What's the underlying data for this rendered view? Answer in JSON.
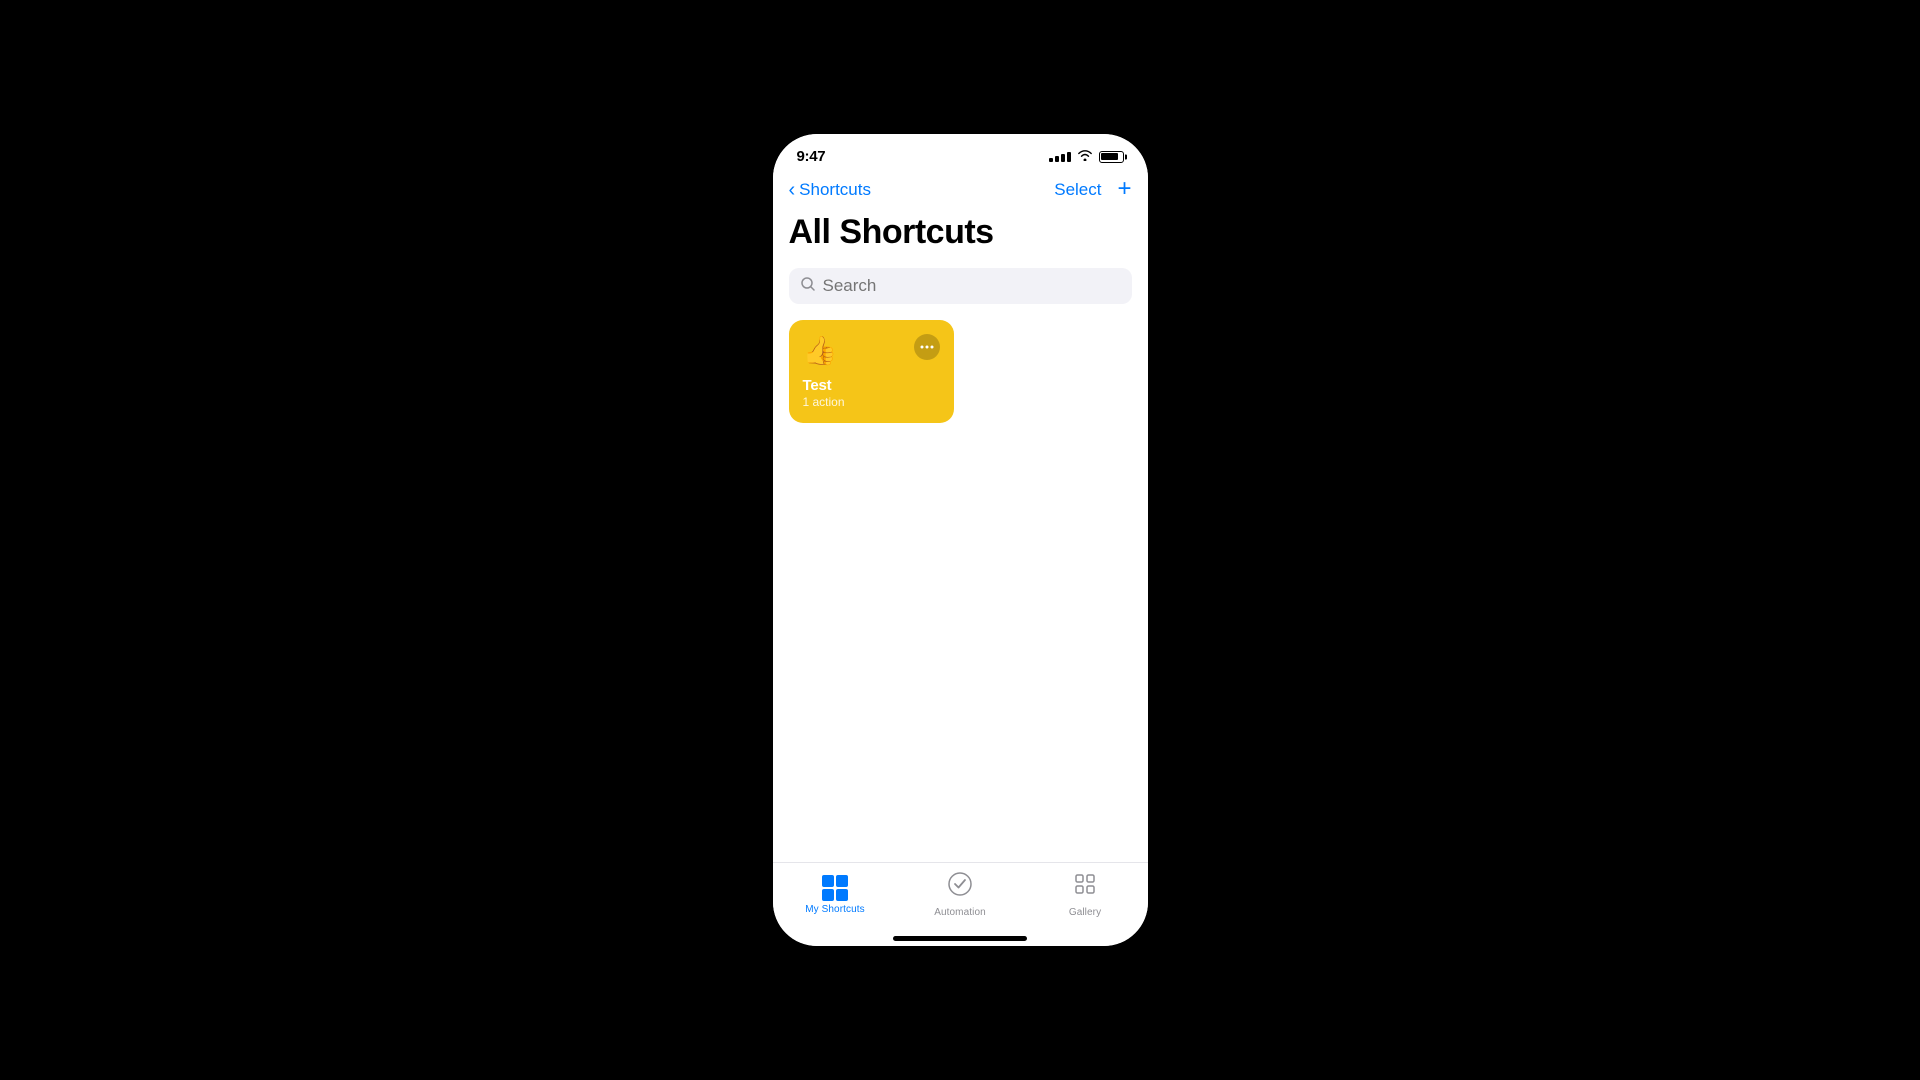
{
  "statusBar": {
    "time": "9:47",
    "signalLabel": "signal",
    "wifiLabel": "wifi",
    "batteryLabel": "battery"
  },
  "navBar": {
    "backLabel": "Shortcuts",
    "selectLabel": "Select",
    "addLabel": "+"
  },
  "pageTitle": "All Shortcuts",
  "searchBar": {
    "placeholder": "Search"
  },
  "shortcuts": [
    {
      "name": "Test",
      "actions": "1 action",
      "iconGlyph": "👍",
      "bgColor": "#F5C518"
    }
  ],
  "tabBar": {
    "items": [
      {
        "id": "my-shortcuts",
        "label": "My Shortcuts",
        "active": true
      },
      {
        "id": "automation",
        "label": "Automation",
        "active": false
      },
      {
        "id": "gallery",
        "label": "Gallery",
        "active": false
      }
    ]
  },
  "icons": {
    "back": "‹",
    "menu": "•••",
    "thumbsUp": "👍",
    "automationSymbol": "✓",
    "gallerySymbol": "⧉"
  }
}
